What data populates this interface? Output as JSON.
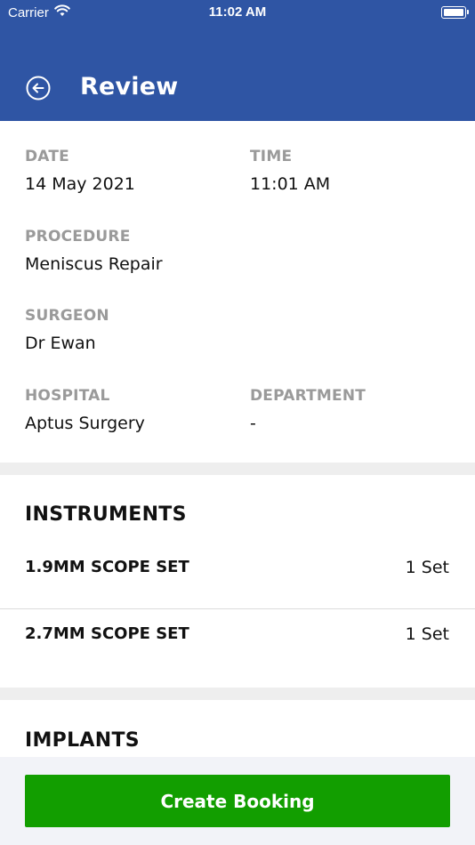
{
  "status_bar": {
    "carrier": "Carrier",
    "time": "11:02 AM"
  },
  "header": {
    "title": "Review"
  },
  "details": {
    "date": {
      "label": "DATE",
      "value": "14 May 2021"
    },
    "time": {
      "label": "TIME",
      "value": "11:01 AM"
    },
    "procedure": {
      "label": "PROCEDURE",
      "value": "Meniscus Repair"
    },
    "surgeon": {
      "label": "SURGEON",
      "value": "Dr Ewan"
    },
    "hospital": {
      "label": "HOSPITAL",
      "value": "Aptus Surgery"
    },
    "department": {
      "label": "DEPARTMENT",
      "value": "-"
    }
  },
  "instruments": {
    "title": "INSTRUMENTS",
    "items": [
      {
        "name": "1.9MM SCOPE SET",
        "quantity": "1 Set"
      },
      {
        "name": "2.7MM SCOPE SET",
        "quantity": "1 Set"
      }
    ]
  },
  "implants": {
    "title": "IMPLANTS"
  },
  "footer": {
    "create_booking_label": "Create Booking"
  },
  "colors": {
    "header": "#2f55a4",
    "primary_button": "#129e00",
    "label_gray": "#9a9a9a"
  }
}
